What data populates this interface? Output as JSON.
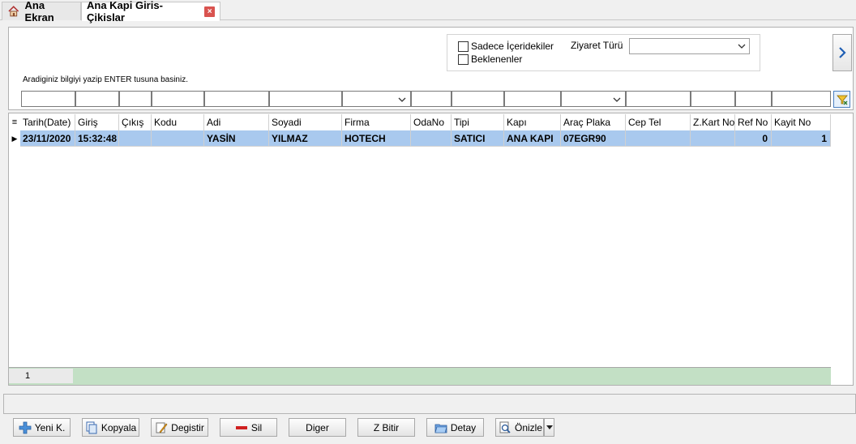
{
  "tabs": {
    "home_label": "Ana Ekran",
    "active_label": "Ana Kapi Giris-Çikislar",
    "close_glyph": "×"
  },
  "filters": {
    "only_inside_label": "Sadece İçeridekiler",
    "expected_label": "Beklenenler",
    "visit_type_label": "Ziyaret Türü",
    "visit_type_value": "",
    "hint": "Aradiginiz bilgiyi yazip ENTER tusuna basiniz.",
    "nav_glyph": "›"
  },
  "grid": {
    "columns": [
      "Tarih(Date)",
      "Giriş",
      "Çıkış",
      "Kodu",
      "Adi",
      "Soyadi",
      "Firma",
      "OdaNo",
      "Tipi",
      "Kapı",
      "Araç Plaka",
      "Cep Tel",
      "Z.Kart No",
      "Ref No",
      "Kayit No"
    ],
    "rows": [
      [
        "23/11/2020",
        "15:32:48",
        "",
        "",
        "YASİN",
        "YILMAZ",
        "HOTECH",
        "",
        "SATICI",
        "ANA KAPI",
        "07EGR90",
        "",
        "",
        "0",
        "1"
      ]
    ],
    "row_indicator": "▶",
    "header_icon": "≡",
    "footer_count": "1"
  },
  "buttons": {
    "new": "Yeni K.",
    "copy": "Kopyala",
    "edit": "Degistir",
    "delete": "Sil",
    "other": "Diger",
    "zend": "Z Bitir",
    "detail": "Detay",
    "preview": "Önizle"
  },
  "colors": {
    "selected_row": "#a9c9ee",
    "footer_bar": "#c3e0c5",
    "accent": "#1f5fb4"
  }
}
